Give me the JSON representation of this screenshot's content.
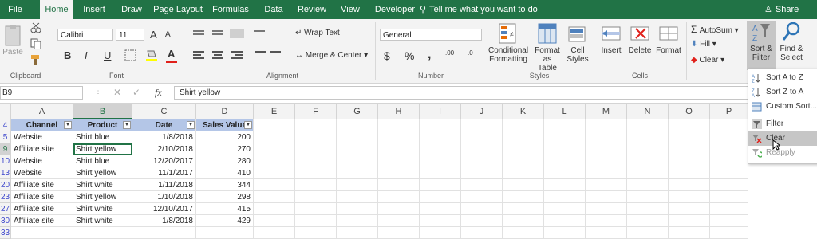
{
  "tabs": [
    "File",
    "Home",
    "Insert",
    "Draw",
    "Page Layout",
    "Formulas",
    "Data",
    "Review",
    "View",
    "Developer"
  ],
  "tell_me": "Tell me what you want to do",
  "share": "Share",
  "clipboard": {
    "paste": "Paste",
    "label": "Clipboard"
  },
  "font": {
    "name": "Calibri",
    "size": "11",
    "label": "Font",
    "grow": "A",
    "shrink": "A",
    "bold": "B",
    "italic": "I",
    "underline": "U",
    "color_letter": "A"
  },
  "alignment": {
    "wrap": "Wrap Text",
    "merge": "Merge & Center",
    "label": "Alignment"
  },
  "number": {
    "format": "General",
    "currency": "$",
    "percent": "%",
    "comma": ",",
    "inc": ".00",
    "dec": ".0",
    "label": "Number"
  },
  "styles": {
    "cond": "Conditional",
    "cond2": "Formatting",
    "table": "Format as",
    "table2": "Table",
    "cell": "Cell",
    "cell2": "Styles",
    "label": "Styles"
  },
  "cells": {
    "insert": "Insert",
    "delete": "Delete",
    "format": "Format",
    "label": "Cells"
  },
  "editing": {
    "autosum": "AutoSum",
    "fill": "Fill",
    "clear": "Clear",
    "sort": "Sort &",
    "sort2": "Filter",
    "find": "Find &",
    "find2": "Select",
    "label": "Editi"
  },
  "formula_bar": {
    "name_box": "B9",
    "fx": "fx",
    "value": "Shirt yellow"
  },
  "columns": [
    "A",
    "B",
    "C",
    "D",
    "E",
    "F",
    "G",
    "H",
    "I",
    "J",
    "K",
    "L",
    "M",
    "N",
    "O",
    "P"
  ],
  "table_headers": [
    "Channel",
    "Product",
    "Date",
    "Sales Value"
  ],
  "rows": [
    {
      "num": "4",
      "cells": [
        "Channel",
        "Product",
        "Date",
        "Sales Value"
      ]
    },
    {
      "num": "5",
      "cells": [
        "Website",
        "Shirt blue",
        "1/8/2018",
        "200"
      ]
    },
    {
      "num": "9",
      "cells": [
        "Affiliate site",
        "Shirt yellow",
        "2/10/2018",
        "270"
      ]
    },
    {
      "num": "10",
      "cells": [
        "Website",
        "Shirt blue",
        "12/20/2017",
        "280"
      ]
    },
    {
      "num": "13",
      "cells": [
        "Website",
        "Shirt yellow",
        "11/1/2017",
        "410"
      ]
    },
    {
      "num": "20",
      "cells": [
        "Affiliate site",
        "Shirt white",
        "1/11/2018",
        "344"
      ]
    },
    {
      "num": "23",
      "cells": [
        "Affiliate site",
        "Shirt yellow",
        "1/10/2018",
        "298"
      ]
    },
    {
      "num": "27",
      "cells": [
        "Affiliate site",
        "Shirt white",
        "12/10/2017",
        "415"
      ]
    },
    {
      "num": "30",
      "cells": [
        "Affiliate site",
        "Shirt white",
        "1/8/2018",
        "429"
      ]
    },
    {
      "num": "33",
      "cells": [
        "",
        "",
        "",
        ""
      ]
    }
  ],
  "sort_menu": [
    {
      "label": "Sort A to Z",
      "disabled": false
    },
    {
      "label": "Sort Z to A",
      "disabled": false
    },
    {
      "label": "Custom Sort...",
      "disabled": false
    },
    {
      "label": "Filter",
      "disabled": false
    },
    {
      "label": "Clear",
      "disabled": false
    },
    {
      "label": "Reapply",
      "disabled": true
    }
  ],
  "colors": {
    "excel_green": "#217346",
    "header_fill": "#b4c6e7"
  }
}
